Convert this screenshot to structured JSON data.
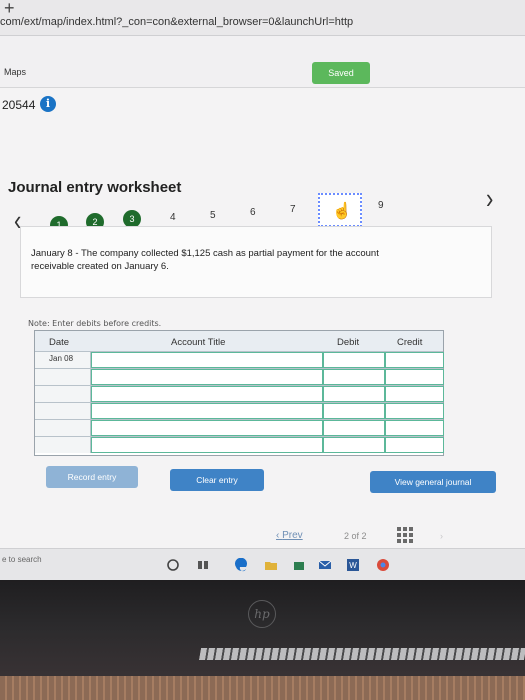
{
  "browser": {
    "url": "com/ext/map/index.html?_con=con&external_browser=0&launchUrl=http"
  },
  "tabs": {
    "maps_label": "Maps"
  },
  "status": {
    "saved_label": "Saved"
  },
  "assignment": {
    "id_text": "20544"
  },
  "worksheet": {
    "title": "Journal entry worksheet",
    "steps": [
      "1",
      "2",
      "3",
      "4",
      "5",
      "6",
      "7",
      "8",
      "9"
    ],
    "current_step": "8",
    "description": "January 8 - The company collected $1,125 cash as partial payment for the account receivable created on January 6.",
    "note": "Note: Enter debits before credits.",
    "columns": {
      "date": "Date",
      "account": "Account Title",
      "debit": "Debit",
      "credit": "Credit"
    },
    "rows": [
      {
        "date": "Jan 08",
        "account": "",
        "debit": "",
        "credit": ""
      },
      {
        "date": "",
        "account": "",
        "debit": "",
        "credit": ""
      },
      {
        "date": "",
        "account": "",
        "debit": "",
        "credit": ""
      },
      {
        "date": "",
        "account": "",
        "debit": "",
        "credit": ""
      },
      {
        "date": "",
        "account": "",
        "debit": "",
        "credit": ""
      },
      {
        "date": "",
        "account": "",
        "debit": "",
        "credit": ""
      }
    ],
    "buttons": {
      "record": "Record entry",
      "clear": "Clear entry",
      "view": "View general journal"
    }
  },
  "pagination": {
    "prev": "Prev",
    "page_indicator": "2 of 2"
  },
  "taskbar": {
    "search_hint": "e to search"
  },
  "colors": {
    "accent_green": "#1f6b2c",
    "button_blue": "#3f83c6",
    "saved_green": "#5cb85c"
  }
}
